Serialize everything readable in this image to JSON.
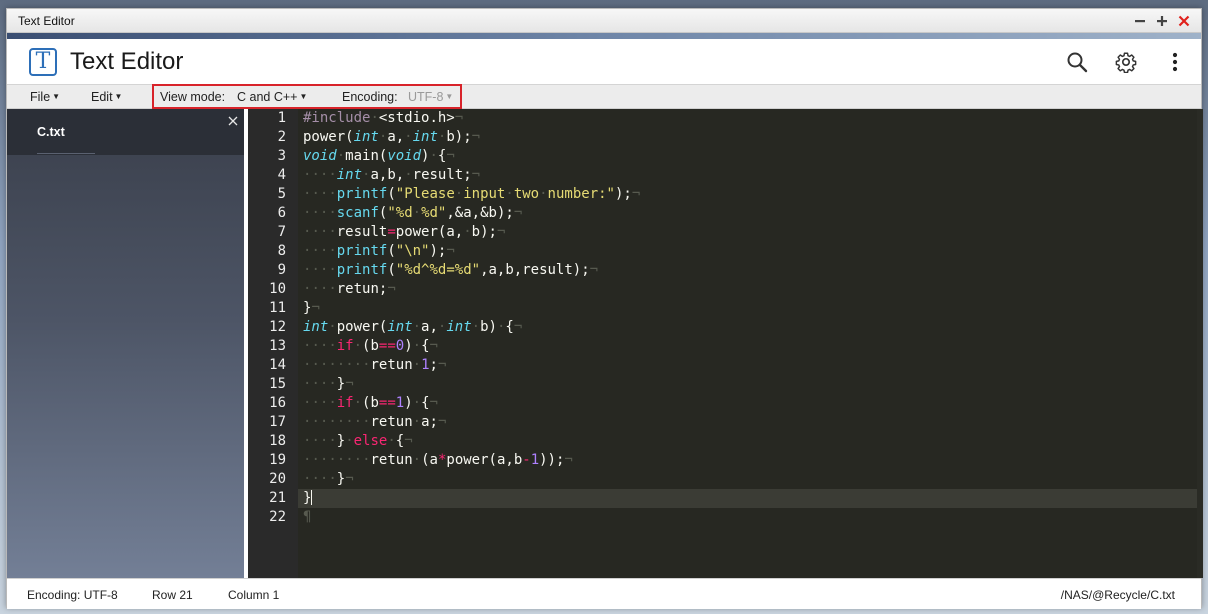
{
  "window": {
    "title": "Text Editor"
  },
  "app": {
    "title": "Text Editor",
    "logo_letter": "T"
  },
  "header_icons": [
    "search-icon",
    "gear-icon",
    "more-vertical-icon"
  ],
  "menubar": {
    "file": "File",
    "edit": "Edit",
    "view_mode_label": "View mode:",
    "view_mode_value": "C and C++",
    "encoding_label": "Encoding:",
    "encoding_value": "UTF-8"
  },
  "tabs": [
    {
      "name": "C.txt",
      "active": true
    }
  ],
  "editor": {
    "current_line": 21,
    "line_numbers": [
      "1",
      "2",
      "3",
      "4",
      "5",
      "6",
      "7",
      "8",
      "9",
      "10",
      "11",
      "12",
      "13",
      "14",
      "15",
      "16",
      "17",
      "18",
      "19",
      "20",
      "21",
      "22"
    ],
    "lines": [
      "#include <stdio.h>",
      "power(int a, int b);",
      "void main(void) {",
      "    int a,b, result;",
      "    printf(\"Please input two number:\");",
      "    scanf(\"%d %d\",&a,&b);",
      "    result=power(a, b);",
      "    printf(\"\\n\");",
      "    printf(\"%d^%d=%d\",a,b,result);",
      "    retun;",
      "}",
      "int power(int a, int b) {",
      "    if (b==0) {",
      "        retun 1;",
      "    }",
      "    if (b==1) {",
      "        retun a;",
      "    } else {",
      "        retun (a*power(a,b-1));",
      "    }",
      "}",
      ""
    ]
  },
  "status": {
    "encoding": "Encoding: UTF-8",
    "row": "Row 21",
    "column": "Column 1",
    "path": "/NAS/@Recycle/C.txt"
  },
  "colors": {
    "editor_bg": "#272822",
    "highlight_border": "#d8232a",
    "accent_blue": "#2d6fb8",
    "close_red": "#e0211c"
  }
}
